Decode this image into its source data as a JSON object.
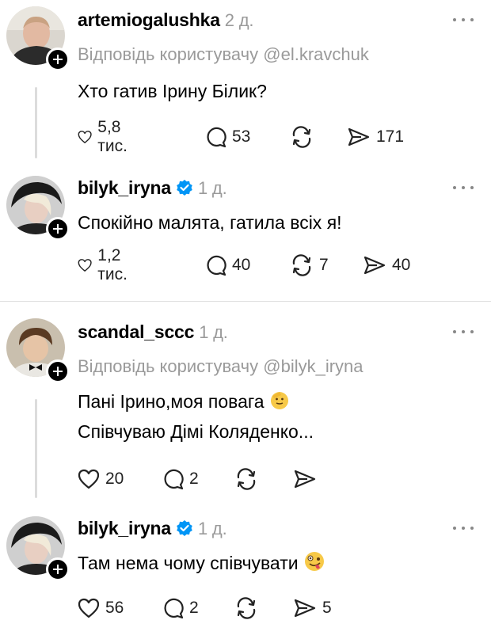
{
  "posts": [
    {
      "username": "artemiogalushka",
      "time": "2 д.",
      "reply_to": "Відповідь користувачу @el.kravchuk",
      "verified": false,
      "lines": [
        "Хто гатив Ірину Білик?"
      ],
      "likes": "5,8 тис.",
      "comments": "53",
      "reposts": "",
      "shares": "171"
    },
    {
      "username": "bilyk_iryna",
      "time": "1 д.",
      "reply_to": "",
      "verified": true,
      "lines": [
        "Спокійно малята, гатила всіх я!"
      ],
      "likes": "1,2 тис.",
      "comments": "40",
      "reposts": "7",
      "shares": "40"
    },
    {
      "username": "scandal_sccc",
      "time": "1 д.",
      "reply_to": "Відповідь користувачу @bilyk_iryna",
      "verified": false,
      "lines": [
        "Пані Ірино,моя повага",
        "Співчуваю Дімі Коляденко..."
      ],
      "likes": "20",
      "comments": "2",
      "reposts": "",
      "shares": ""
    },
    {
      "username": "bilyk_iryna",
      "time": "1 д.",
      "reply_to": "",
      "verified": true,
      "lines": [
        "Там нема чому співчувати"
      ],
      "likes": "56",
      "comments": "2",
      "reposts": "",
      "shares": "5"
    }
  ],
  "icons": {
    "like": "heart-icon",
    "comment": "comment-bubble-icon",
    "repost": "repost-icon",
    "share": "share-send-icon",
    "verified": "verified-badge-icon",
    "follow": "plus-follow-icon",
    "more": "more-options-icon",
    "emoji_1": "salute-face-emoji",
    "emoji_2": "zany-face-emoji"
  },
  "colors": {
    "accent": "#0095f6",
    "muted": "#9a9a9a",
    "text": "#000000"
  }
}
